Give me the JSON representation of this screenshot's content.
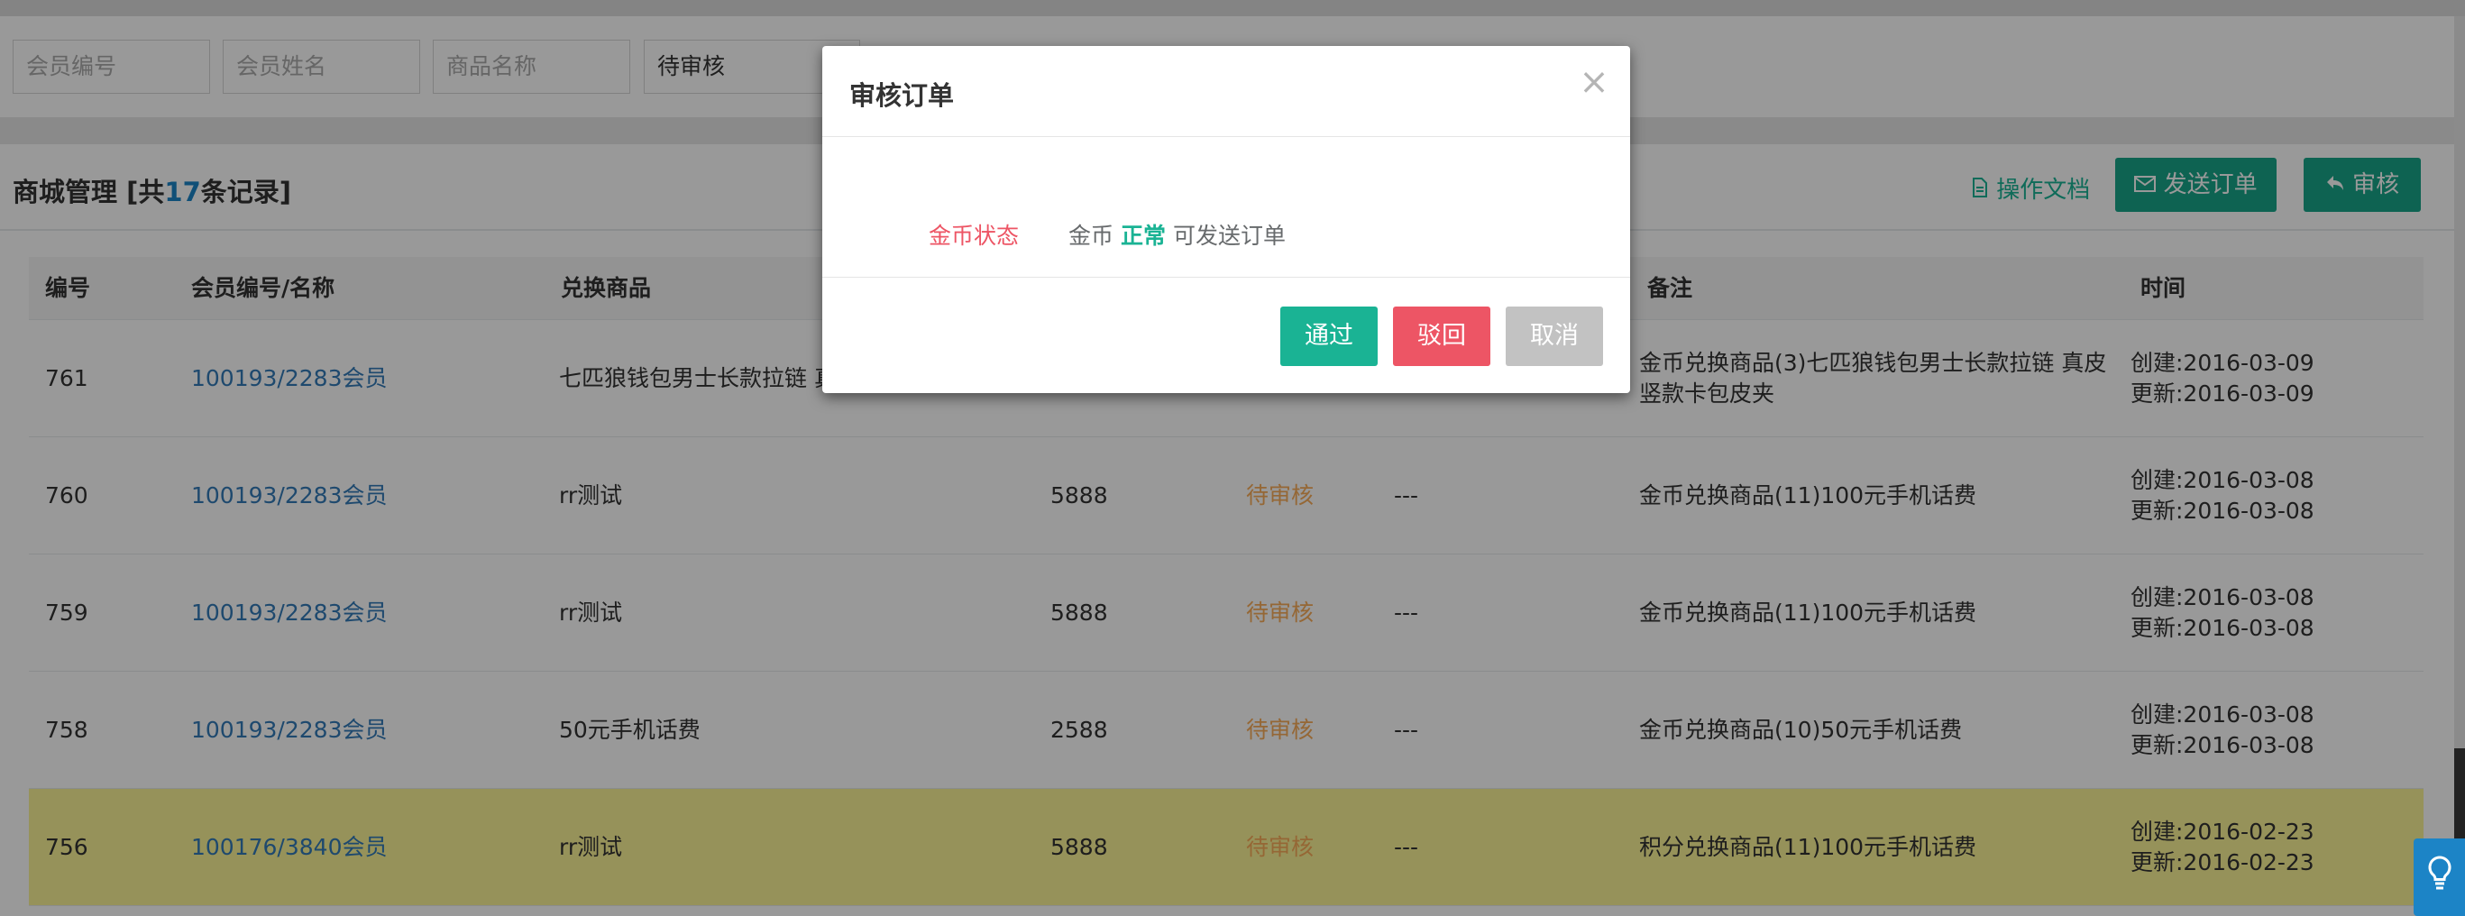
{
  "filters": {
    "member_id_placeholder": "会员编号",
    "member_name_placeholder": "会员姓名",
    "product_name_placeholder": "商品名称",
    "status_selected": "待审核"
  },
  "panel": {
    "title_prefix": "商城管理",
    "title_mid_open": "[共",
    "record_count": "17",
    "title_mid_close": "条记录]",
    "doc_link": "操作文档",
    "send_order_button": "发送订单",
    "audit_button": "审核"
  },
  "table": {
    "headers": [
      "编号",
      "会员编号/名称",
      "兑换商品",
      "备注",
      "时间"
    ],
    "rows": [
      {
        "id": "761",
        "member": "100193/2283会员",
        "product": "七匹狼钱包男士长款拉链 真皮竖款卡包皮夹",
        "amount": "",
        "status": "",
        "extra": "",
        "remark": "金币兑换商品(3)七匹狼钱包男士长款拉链 真皮竖款卡包皮夹",
        "created": "创建:2016-03-09",
        "updated": "更新:2016-03-09"
      },
      {
        "id": "760",
        "member": "100193/2283会员",
        "product": "rr测试",
        "amount": "5888",
        "status": "待审核",
        "extra": "---",
        "remark": "金币兑换商品(11)100元手机话费",
        "created": "创建:2016-03-08",
        "updated": "更新:2016-03-08"
      },
      {
        "id": "759",
        "member": "100193/2283会员",
        "product": "rr测试",
        "amount": "5888",
        "status": "待审核",
        "extra": "---",
        "remark": "金币兑换商品(11)100元手机话费",
        "created": "创建:2016-03-08",
        "updated": "更新:2016-03-08"
      },
      {
        "id": "758",
        "member": "100193/2283会员",
        "product": "50元手机话费",
        "amount": "2588",
        "status": "待审核",
        "extra": "---",
        "remark": "金币兑换商品(10)50元手机话费",
        "created": "创建:2016-03-08",
        "updated": "更新:2016-03-08"
      },
      {
        "id": "756",
        "member": "100176/3840会员",
        "product": "rr测试",
        "amount": "5888",
        "status": "待审核",
        "extra": "---",
        "remark": "积分兑换商品(11)100元手机话费",
        "created": "创建:2016-02-23",
        "updated": "更新:2016-02-23"
      }
    ]
  },
  "modal": {
    "title": "审核订单",
    "close_glyph": "×",
    "status_label": "金币状态",
    "status_prefix": "金币",
    "status_value": "正常",
    "status_suffix": "可发送订单",
    "pass_button": "通过",
    "reject_button": "驳回",
    "cancel_button": "取消"
  },
  "icons": {
    "doc": "file-icon",
    "send": "envelope-icon",
    "audit": "reply-icon",
    "help": "lightbulb-icon"
  },
  "colors": {
    "primary": "#1ab394",
    "danger": "#ed5565",
    "warning": "#f8ac59",
    "link": "#337ab7",
    "highlight_row": "#fbf397"
  }
}
